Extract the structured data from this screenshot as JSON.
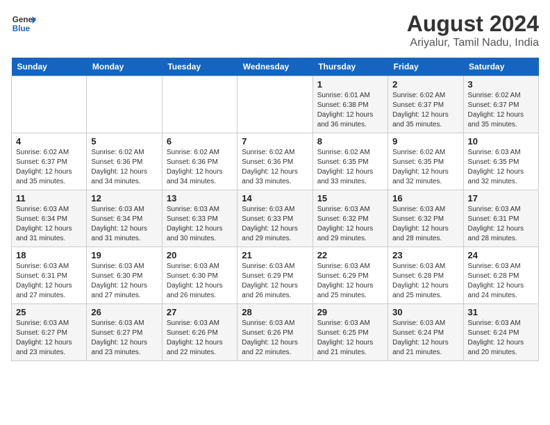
{
  "logo": {
    "line1": "General",
    "line2": "Blue"
  },
  "title": "August 2024",
  "subtitle": "Ariyalur, Tamil Nadu, India",
  "headers": [
    "Sunday",
    "Monday",
    "Tuesday",
    "Wednesday",
    "Thursday",
    "Friday",
    "Saturday"
  ],
  "weeks": [
    [
      {
        "day": "",
        "info": ""
      },
      {
        "day": "",
        "info": ""
      },
      {
        "day": "",
        "info": ""
      },
      {
        "day": "",
        "info": ""
      },
      {
        "day": "1",
        "info": "Sunrise: 6:01 AM\nSunset: 6:38 PM\nDaylight: 12 hours\nand 36 minutes."
      },
      {
        "day": "2",
        "info": "Sunrise: 6:02 AM\nSunset: 6:37 PM\nDaylight: 12 hours\nand 35 minutes."
      },
      {
        "day": "3",
        "info": "Sunrise: 6:02 AM\nSunset: 6:37 PM\nDaylight: 12 hours\nand 35 minutes."
      }
    ],
    [
      {
        "day": "4",
        "info": "Sunrise: 6:02 AM\nSunset: 6:37 PM\nDaylight: 12 hours\nand 35 minutes."
      },
      {
        "day": "5",
        "info": "Sunrise: 6:02 AM\nSunset: 6:36 PM\nDaylight: 12 hours\nand 34 minutes."
      },
      {
        "day": "6",
        "info": "Sunrise: 6:02 AM\nSunset: 6:36 PM\nDaylight: 12 hours\nand 34 minutes."
      },
      {
        "day": "7",
        "info": "Sunrise: 6:02 AM\nSunset: 6:36 PM\nDaylight: 12 hours\nand 33 minutes."
      },
      {
        "day": "8",
        "info": "Sunrise: 6:02 AM\nSunset: 6:35 PM\nDaylight: 12 hours\nand 33 minutes."
      },
      {
        "day": "9",
        "info": "Sunrise: 6:02 AM\nSunset: 6:35 PM\nDaylight: 12 hours\nand 32 minutes."
      },
      {
        "day": "10",
        "info": "Sunrise: 6:03 AM\nSunset: 6:35 PM\nDaylight: 12 hours\nand 32 minutes."
      }
    ],
    [
      {
        "day": "11",
        "info": "Sunrise: 6:03 AM\nSunset: 6:34 PM\nDaylight: 12 hours\nand 31 minutes."
      },
      {
        "day": "12",
        "info": "Sunrise: 6:03 AM\nSunset: 6:34 PM\nDaylight: 12 hours\nand 31 minutes."
      },
      {
        "day": "13",
        "info": "Sunrise: 6:03 AM\nSunset: 6:33 PM\nDaylight: 12 hours\nand 30 minutes."
      },
      {
        "day": "14",
        "info": "Sunrise: 6:03 AM\nSunset: 6:33 PM\nDaylight: 12 hours\nand 29 minutes."
      },
      {
        "day": "15",
        "info": "Sunrise: 6:03 AM\nSunset: 6:32 PM\nDaylight: 12 hours\nand 29 minutes."
      },
      {
        "day": "16",
        "info": "Sunrise: 6:03 AM\nSunset: 6:32 PM\nDaylight: 12 hours\nand 28 minutes."
      },
      {
        "day": "17",
        "info": "Sunrise: 6:03 AM\nSunset: 6:31 PM\nDaylight: 12 hours\nand 28 minutes."
      }
    ],
    [
      {
        "day": "18",
        "info": "Sunrise: 6:03 AM\nSunset: 6:31 PM\nDaylight: 12 hours\nand 27 minutes."
      },
      {
        "day": "19",
        "info": "Sunrise: 6:03 AM\nSunset: 6:30 PM\nDaylight: 12 hours\nand 27 minutes."
      },
      {
        "day": "20",
        "info": "Sunrise: 6:03 AM\nSunset: 6:30 PM\nDaylight: 12 hours\nand 26 minutes."
      },
      {
        "day": "21",
        "info": "Sunrise: 6:03 AM\nSunset: 6:29 PM\nDaylight: 12 hours\nand 26 minutes."
      },
      {
        "day": "22",
        "info": "Sunrise: 6:03 AM\nSunset: 6:29 PM\nDaylight: 12 hours\nand 25 minutes."
      },
      {
        "day": "23",
        "info": "Sunrise: 6:03 AM\nSunset: 6:28 PM\nDaylight: 12 hours\nand 25 minutes."
      },
      {
        "day": "24",
        "info": "Sunrise: 6:03 AM\nSunset: 6:28 PM\nDaylight: 12 hours\nand 24 minutes."
      }
    ],
    [
      {
        "day": "25",
        "info": "Sunrise: 6:03 AM\nSunset: 6:27 PM\nDaylight: 12 hours\nand 23 minutes."
      },
      {
        "day": "26",
        "info": "Sunrise: 6:03 AM\nSunset: 6:27 PM\nDaylight: 12 hours\nand 23 minutes."
      },
      {
        "day": "27",
        "info": "Sunrise: 6:03 AM\nSunset: 6:26 PM\nDaylight: 12 hours\nand 22 minutes."
      },
      {
        "day": "28",
        "info": "Sunrise: 6:03 AM\nSunset: 6:26 PM\nDaylight: 12 hours\nand 22 minutes."
      },
      {
        "day": "29",
        "info": "Sunrise: 6:03 AM\nSunset: 6:25 PM\nDaylight: 12 hours\nand 21 minutes."
      },
      {
        "day": "30",
        "info": "Sunrise: 6:03 AM\nSunset: 6:24 PM\nDaylight: 12 hours\nand 21 minutes."
      },
      {
        "day": "31",
        "info": "Sunrise: 6:03 AM\nSunset: 6:24 PM\nDaylight: 12 hours\nand 20 minutes."
      }
    ]
  ]
}
